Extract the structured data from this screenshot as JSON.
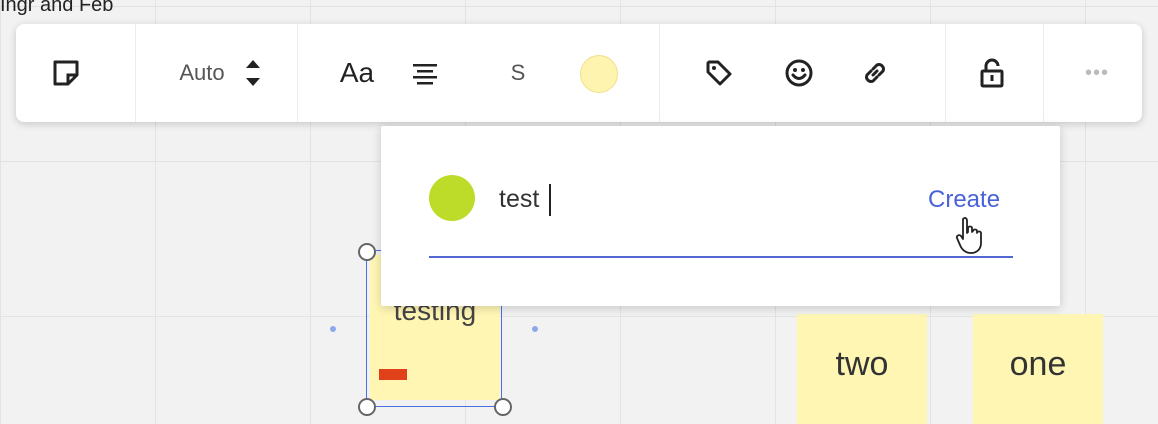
{
  "clipped_top_text": "Ingr and Feb",
  "toolbar": {
    "size_label": "Auto",
    "font_label": "Aa",
    "text_size_label": "S",
    "icons": [
      "sticky-note-icon",
      "stepper-icon",
      "align-center-icon",
      "tag-icon",
      "emoji-icon",
      "link-icon",
      "lock-icon",
      "more-icon"
    ],
    "color_swatch": "#fff3b0"
  },
  "tag_popover": {
    "input_value": "test",
    "create_label": "Create",
    "tag_color": "#bddc2a"
  },
  "canvas": {
    "selected_sticky_text": "testing",
    "sticky_two_text": "two",
    "sticky_one_text": "one",
    "sticky_color": "#fff6b4",
    "tag_stripe_color": "#e0401a"
  }
}
